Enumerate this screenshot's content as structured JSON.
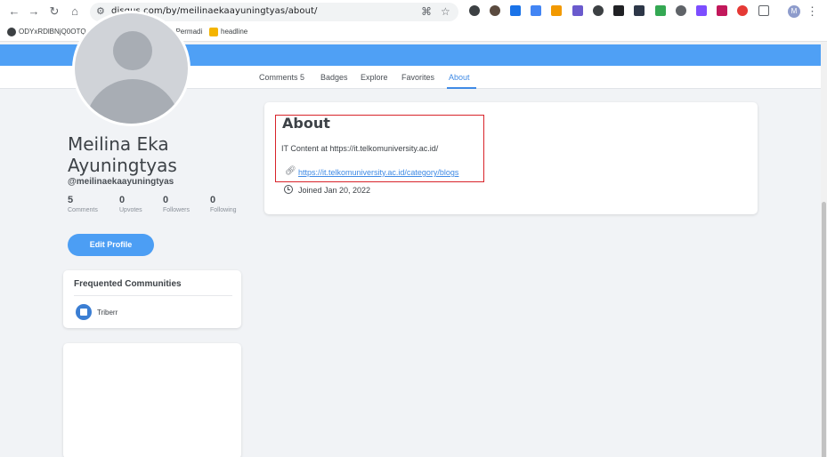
{
  "browser": {
    "url": "disqus.com/by/meilinaekaayuningtyas/about/",
    "bookmarks": [
      {
        "label": "ODYxRDlBNjQ0OTQ..."
      },
      {
        "label": ""
      },
      {
        "label": ""
      },
      {
        "label": "Bambang Permadi"
      },
      {
        "label": "headline"
      }
    ],
    "profile_initial": "M"
  },
  "tabs": [
    {
      "label": "Comments 5"
    },
    {
      "label": "Badges"
    },
    {
      "label": "Explore"
    },
    {
      "label": "Favorites"
    },
    {
      "label": "About",
      "active": true
    }
  ],
  "profile": {
    "name": "Meilina Eka Ayuningtyas",
    "handle": "@meilinaekaayuningtyas",
    "stats": [
      {
        "value": "5",
        "label": "Comments"
      },
      {
        "value": "0",
        "label": "Upvotes"
      },
      {
        "value": "0",
        "label": "Followers"
      },
      {
        "value": "0",
        "label": "Following"
      }
    ],
    "edit_label": "Edit Profile"
  },
  "communities": {
    "title": "Frequented Communities",
    "items": [
      {
        "name": "Triberr"
      }
    ]
  },
  "about": {
    "heading": "About",
    "bio": "IT Content at https://it.telkomuniversity.ac.id/",
    "link": "https://it.telkomuniversity.ac.id/category/blogs",
    "joined": "Joined Jan 20, 2022"
  },
  "colors": {
    "accent": "#4fa0f5",
    "link": "#3f8ae5",
    "highlight": "#d8232a"
  }
}
